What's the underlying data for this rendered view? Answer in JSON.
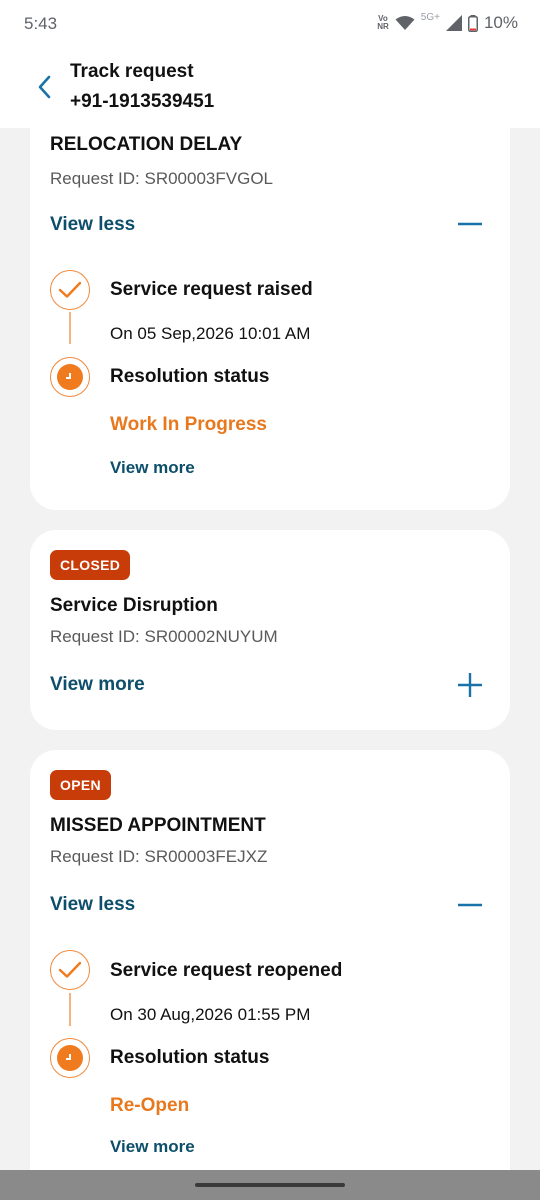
{
  "status_bar": {
    "time": "5:43",
    "volte_top": "Vo",
    "volte_bottom": "NR",
    "network": "5G+",
    "battery": "10%"
  },
  "header": {
    "title": "Track request",
    "phone": "+91-1913539451"
  },
  "cards": [
    {
      "title": "RELOCATION DELAY",
      "request_id": "Request ID: SR00003FVGOL",
      "toggle_label": "View less",
      "expanded": true,
      "timeline": {
        "event_title": "Service request raised",
        "event_date": "On 05 Sep,2026 10:01 AM",
        "resolution_label": "Resolution status",
        "resolution_value": "Work In Progress",
        "view_more": "View more"
      }
    },
    {
      "badge": "CLOSED",
      "title": "Service Disruption",
      "request_id": "Request ID: SR00002NUYUM",
      "toggle_label": "View more",
      "expanded": false
    },
    {
      "badge": "OPEN",
      "title": "MISSED APPOINTMENT",
      "request_id": "Request ID: SR00003FEJXZ",
      "toggle_label": "View less",
      "expanded": true,
      "timeline": {
        "event_title": "Service request reopened",
        "event_date": "On 30 Aug,2026 01:55 PM",
        "resolution_label": "Resolution status",
        "resolution_value": "Re-Open",
        "view_more": "View more"
      }
    }
  ],
  "colors": {
    "badge_bg": "#c83c0a",
    "link": "#0d4f6b",
    "accent_orange": "#e8781e",
    "toggle_icon": "#1a73a8"
  },
  "icons": {
    "back": "chevron-left-icon",
    "collapse": "minus-icon",
    "expand": "plus-icon",
    "step_done": "check-icon",
    "step_pending": "clock-icon"
  }
}
